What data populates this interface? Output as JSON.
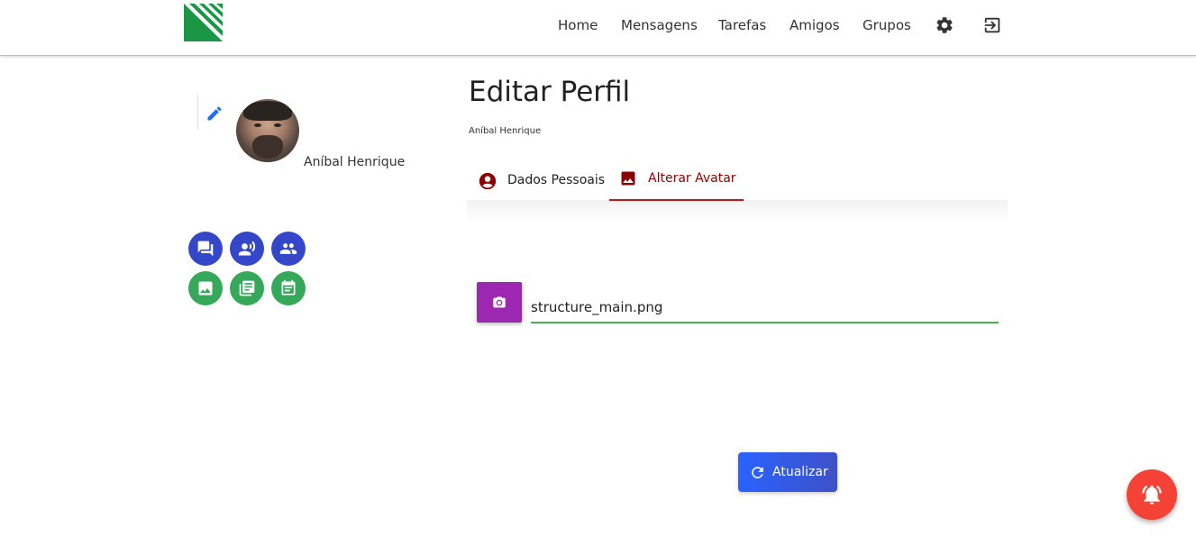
{
  "nav": {
    "items": [
      {
        "label": "Home"
      },
      {
        "label": "Mensagens"
      },
      {
        "label": "Tarefas"
      },
      {
        "label": "Amigos"
      },
      {
        "label": "Grupos"
      }
    ],
    "icons": [
      "gear-icon",
      "logout-icon"
    ]
  },
  "profile": {
    "name": "Aníbal Henrique",
    "quick_actions": [
      {
        "icon": "forum-icon",
        "color": "#3547c9"
      },
      {
        "icon": "record-voice-icon",
        "color": "#3547c9"
      },
      {
        "icon": "people-icon",
        "color": "#3547c9"
      },
      {
        "icon": "image-icon",
        "color": "#35a85a"
      },
      {
        "icon": "newspaper-icon",
        "color": "#35a85a"
      },
      {
        "icon": "calendar-icon",
        "color": "#35a85a"
      }
    ]
  },
  "main": {
    "title": "Editar Perfil",
    "subtitle": "Aníbal Henrique",
    "tabs": [
      {
        "label": "Dados Pessoais",
        "icon": "account-circle-icon",
        "active": false
      },
      {
        "label": "Alterar Avatar",
        "icon": "image-icon",
        "active": true
      }
    ],
    "file_input": {
      "value": "structure_main.png"
    },
    "update_button": {
      "label": "Atualizar"
    }
  },
  "colors": {
    "accent_red": "#b71c1c",
    "purple": "#9c27b0",
    "blue": "#2962ff",
    "green": "#4caf50",
    "fab_red": "#f44336"
  }
}
